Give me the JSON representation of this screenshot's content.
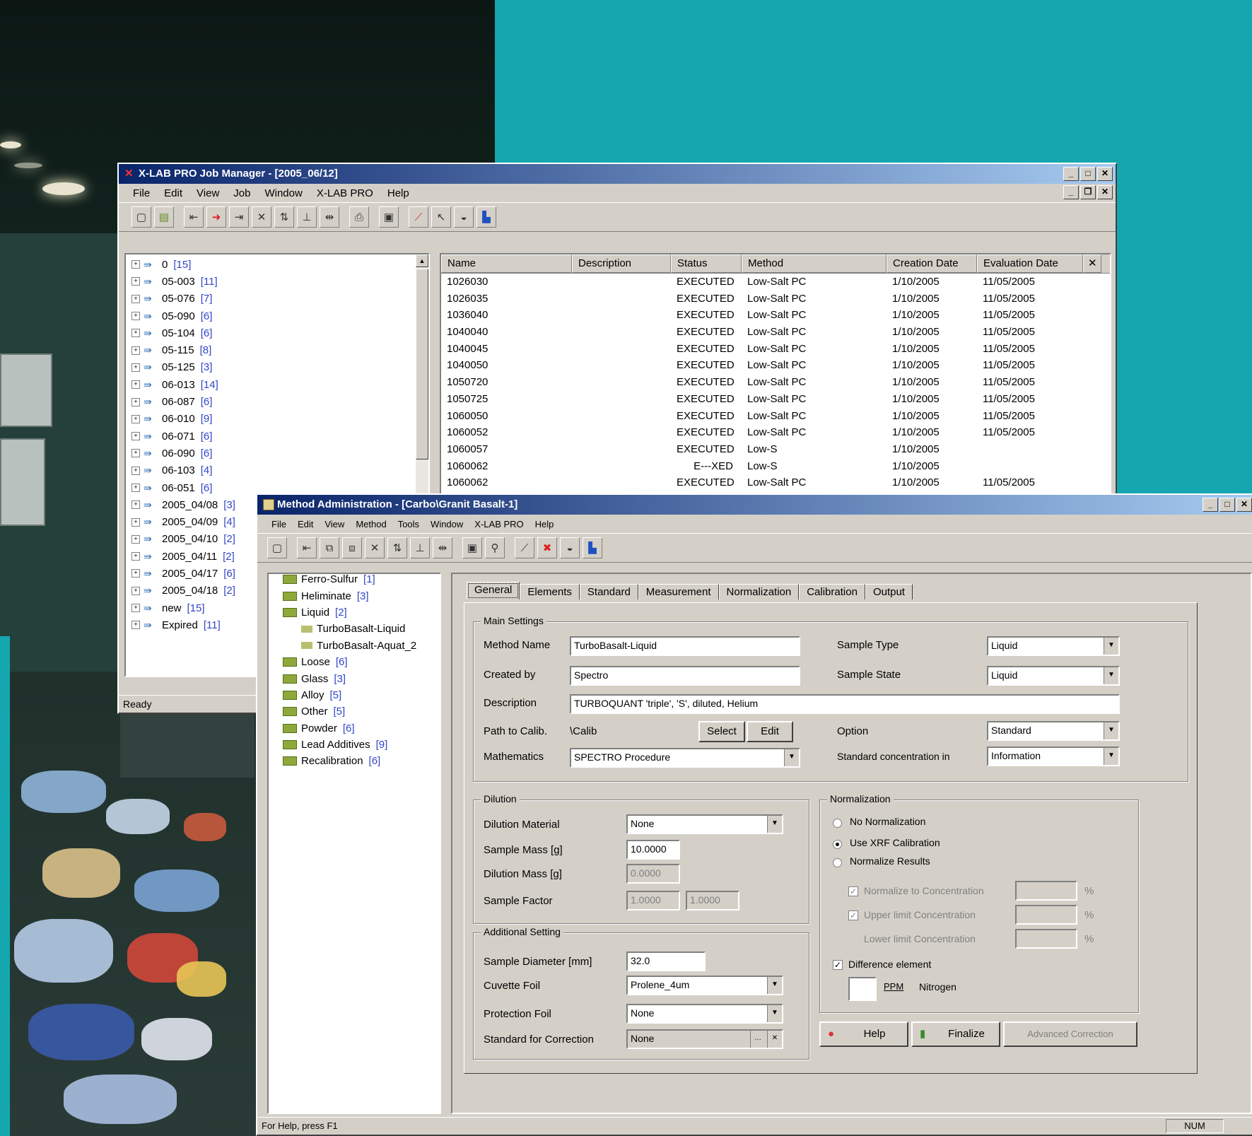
{
  "job_manager": {
    "title": "X-LAB PRO Job Manager - [2005_06/12]",
    "menu": [
      "File",
      "Edit",
      "View",
      "Job",
      "Window",
      "X-LAB PRO",
      "Help"
    ],
    "tree": [
      {
        "label": "0",
        "count": "[15]"
      },
      {
        "label": "05-003",
        "count": "[11]"
      },
      {
        "label": "05-076",
        "count": "[7]"
      },
      {
        "label": "05-090",
        "count": "[6]"
      },
      {
        "label": "05-104",
        "count": "[6]"
      },
      {
        "label": "05-115",
        "count": "[8]"
      },
      {
        "label": "05-125",
        "count": "[3]"
      },
      {
        "label": "06-013",
        "count": "[14]"
      },
      {
        "label": "06-087",
        "count": "[6]"
      },
      {
        "label": "06-010",
        "count": "[9]"
      },
      {
        "label": "06-071",
        "count": "[6]"
      },
      {
        "label": "06-090",
        "count": "[6]"
      },
      {
        "label": "06-103",
        "count": "[4]"
      },
      {
        "label": "06-051",
        "count": "[6]"
      },
      {
        "label": "2005_04/08",
        "count": "[3]"
      },
      {
        "label": "2005_04/09",
        "count": "[4]"
      },
      {
        "label": "2005_04/10",
        "count": "[2]"
      },
      {
        "label": "2005_04/11",
        "count": "[2]"
      },
      {
        "label": "2005_04/17",
        "count": "[6]"
      },
      {
        "label": "2005_04/18",
        "count": "[2]"
      },
      {
        "label": "new",
        "count": "[15]"
      },
      {
        "label": "Expired",
        "count": "[11]"
      }
    ],
    "columns": [
      "Name",
      "Description",
      "Status",
      "Method",
      "Creation Date",
      "Evaluation Date"
    ],
    "rows": [
      [
        "1026030",
        "",
        "EXECUTED",
        "Low-Salt PC",
        "1/10/2005",
        "11/05/2005"
      ],
      [
        "1026035",
        "",
        "EXECUTED",
        "Low-Salt PC",
        "1/10/2005",
        "11/05/2005"
      ],
      [
        "1036040",
        "",
        "EXECUTED",
        "Low-Salt PC",
        "1/10/2005",
        "11/05/2005"
      ],
      [
        "1040040",
        "",
        "EXECUTED",
        "Low-Salt PC",
        "1/10/2005",
        "11/05/2005"
      ],
      [
        "1040045",
        "",
        "EXECUTED",
        "Low-Salt PC",
        "1/10/2005",
        "11/05/2005"
      ],
      [
        "1040050",
        "",
        "EXECUTED",
        "Low-Salt PC",
        "1/10/2005",
        "11/05/2005"
      ],
      [
        "1050720",
        "",
        "EXECUTED",
        "Low-Salt PC",
        "1/10/2005",
        "11/05/2005"
      ],
      [
        "1050725",
        "",
        "EXECUTED",
        "Low-Salt PC",
        "1/10/2005",
        "11/05/2005"
      ],
      [
        "1060050",
        "",
        "EXECUTED",
        "Low-Salt PC",
        "1/10/2005",
        "11/05/2005"
      ],
      [
        "1060052",
        "",
        "EXECUTED",
        "Low-Salt PC",
        "1/10/2005",
        "11/05/2005"
      ],
      [
        "1060057",
        "",
        "EXECUTED",
        "Low-S",
        "1/10/2005",
        ""
      ],
      [
        "1060062",
        "",
        "E---XED",
        "Low-S",
        "1/10/2005",
        ""
      ],
      [
        "1060062",
        "",
        "EXECUTED",
        "Low-Salt PC",
        "1/10/2005",
        "11/05/2005"
      ]
    ],
    "status": "Ready"
  },
  "method_admin": {
    "title": "Method Administration - [Carbo\\Granit Basalt-1]",
    "menu": [
      "File",
      "Edit",
      "View",
      "Method",
      "Tools",
      "Window",
      "X-LAB PRO",
      "Help"
    ],
    "tree": [
      {
        "label": "Ferro-Sulfur",
        "count": "[1]",
        "indent": 1
      },
      {
        "label": "Heliminate",
        "count": "[3]",
        "indent": 1
      },
      {
        "label": "Liquid",
        "count": "[2]",
        "indent": 1
      },
      {
        "label": "TurboBasalt-Liquid",
        "count": "",
        "indent": 2
      },
      {
        "label": "TurboBasalt-Aquat_2",
        "count": "",
        "indent": 2
      },
      {
        "label": "Loose",
        "count": "[6]",
        "indent": 1
      },
      {
        "label": "Glass",
        "count": "[3]",
        "indent": 1
      },
      {
        "label": "Alloy",
        "count": "[5]",
        "indent": 1
      },
      {
        "label": "Other",
        "count": "[5]",
        "indent": 1
      },
      {
        "label": "Powder",
        "count": "[6]",
        "indent": 1
      },
      {
        "label": "Lead Additives",
        "count": "[9]",
        "indent": 1
      },
      {
        "label": "Recalibration",
        "count": "[6]",
        "indent": 1
      }
    ],
    "tabs": [
      "General",
      "Elements",
      "Standard",
      "Measurement",
      "Normalization",
      "Calibration",
      "Output"
    ],
    "general": {
      "group_main": "Main Settings",
      "method_name_label": "Method Name",
      "method_name": "TurboBasalt-Liquid",
      "created_by_label": "Created by",
      "created_by": "Spectro",
      "description_label": "Description",
      "description": "TURBOQUANT 'triple', 'S', diluted, Helium",
      "path_label": "Path to Calib.",
      "path_value": "\\Calib",
      "select_button": "Select",
      "edit_button": "Edit",
      "sample_type_label": "Sample Type",
      "sample_type": "Liquid",
      "sample_state_label": "Sample State",
      "sample_state": "Liquid",
      "option_label": "Option",
      "option": "Standard",
      "mathematics_label": "Mathematics",
      "mathematics": "SPECTRO Procedure",
      "standard_concentration_label": "Standard concentration in",
      "standard_concentration": "Information",
      "group_dilution": "Dilution",
      "dilution_material_label": "Dilution Material",
      "dilution_material": "None",
      "sample_mass_label": "Sample Mass [g]",
      "sample_mass": "10.0000",
      "dilution_mass_label": "Dilution Mass [g]",
      "dilution_mass": "0.0000",
      "sample_factor_label": "Sample Factor",
      "sample_factor_1": "1.0000",
      "sample_factor_2": "1.0000",
      "group_additional": "Additional Setting",
      "sample_diameter_label": "Sample Diameter [mm]",
      "sample_diameter": "32.0",
      "cuvette_foil_label": "Cuvette Foil",
      "cuvette_foil": "Prolene_4um",
      "protection_foil_label": "Protection Foil",
      "protection_foil": "None",
      "standard_for_correction_label": "Standard for Correction",
      "standard_for_correction": "None",
      "group_normalization": "Normalization",
      "radio_1": "No Normalization",
      "radio_2": "Use XRF Calibration",
      "radio_3": "Normalize Results",
      "norm_opt_1": "Normalize to Concentration",
      "norm_opt_2": "Upper limit Concentration",
      "norm_opt_3": "Lower limit Concentration",
      "unit": "%",
      "difference_label": "Difference element",
      "ppm": "PPM",
      "nitrogen": "Nitrogen",
      "help_button": "Help",
      "finalize_button": "Finalize",
      "advanced_button": "Advanced Correction"
    },
    "status": "For Help, press F1",
    "status_right": "NUM"
  },
  "colors": {
    "teal": "#15a7b0",
    "title_start": "#0a246a",
    "title_end": "#a6caf0",
    "window": "#d4d0c8",
    "count_blue": "#3346c6"
  }
}
